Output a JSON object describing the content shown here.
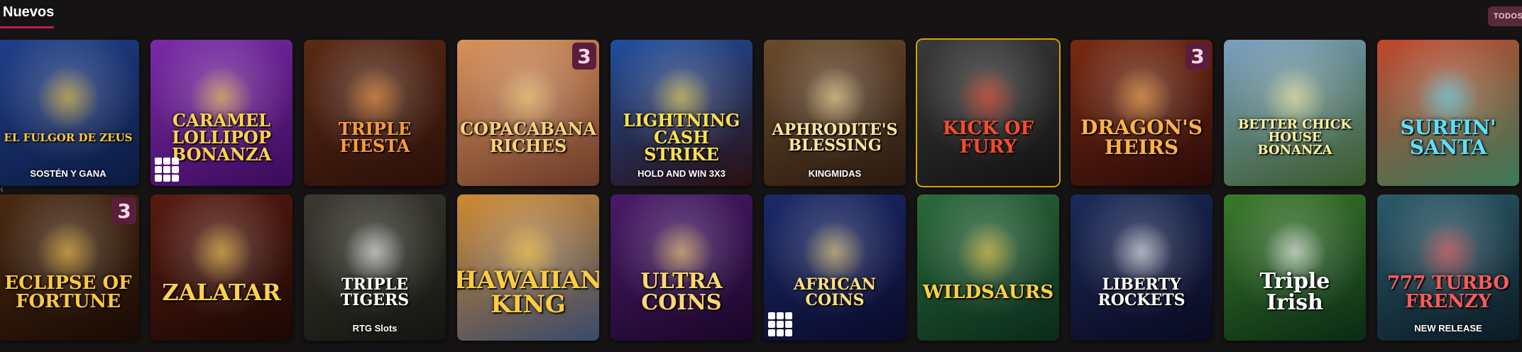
{
  "section": {
    "title": "Nuevos",
    "all_label": "TODOS"
  },
  "games": [
    {
      "name": "EL FULGOR DE ZEUS",
      "subtitle": "SOSTÉN Y GANA",
      "bg1": "#1f3f8a",
      "bg2": "#0b1a40",
      "text": "#ffcc33",
      "size": "15px"
    },
    {
      "name": "CARAMEL LOLLIPOP BONANZA",
      "bg1": "#7b2aa8",
      "bg2": "#3b0b5a",
      "text": "#ffd34a",
      "size": "24px",
      "dots": true
    },
    {
      "name": "TRIPLE FIESTA",
      "bg1": "#5a2a14",
      "bg2": "#2a0f08",
      "text": "#ff9a3c",
      "size": "24px"
    },
    {
      "name": "COPACABANA RICHES",
      "bg1": "#d9925a",
      "bg2": "#6b3a2a",
      "text": "#f7d27a",
      "size": "24px",
      "badge": "3"
    },
    {
      "name": "LIGHTNING CASH STRIKE",
      "subtitle": "HOLD AND WIN 3X3",
      "bg1": "#1f4fa0",
      "bg2": "#2a0f10",
      "text": "#ffe04a",
      "size": "24px"
    },
    {
      "name": "APHRODITE'S BLESSING",
      "subtitle": "KINGMIDAS",
      "bg1": "#6a4a2a",
      "bg2": "#2a1a10",
      "text": "#ffe7a0",
      "size": "22px"
    },
    {
      "name": "KICK OF FURY",
      "bg1": "#3a3a3a",
      "bg2": "#111",
      "text": "#ff4a2a",
      "size": "26px",
      "border": "#d4a200"
    },
    {
      "name": "DRAGON'S HEIRS",
      "bg1": "#7a2a10",
      "bg2": "#2a0a08",
      "text": "#ffb24a",
      "size": "28px",
      "badge": "3"
    },
    {
      "name": "BETTER CHICK HOUSE BONANZA",
      "bg1": "#7aa0c0",
      "bg2": "#3a5a2a",
      "text": "#fff29a",
      "size": "18px"
    },
    {
      "name": "SURFIN' SANTA",
      "bg1": "#c0462a",
      "bg2": "#3a7a5a",
      "text": "#5ae0ff",
      "size": "28px"
    },
    {
      "name": "ECLIPSE OF FORTUNE",
      "bg1": "#4a2a10",
      "bg2": "#1a0a04",
      "text": "#ffc840",
      "size": "26px",
      "badge": "3"
    },
    {
      "name": "ZALATAR",
      "bg1": "#5a1a10",
      "bg2": "#1a0804",
      "text": "#ffd24a",
      "size": "32px"
    },
    {
      "name": "TRIPLE TIGERS",
      "subtitle": "RTG Slots",
      "bg1": "#3a3a30",
      "bg2": "#141410",
      "text": "#ffffff",
      "size": "22px"
    },
    {
      "name": "HAWAIIAN KING",
      "bg1": "#d08a30",
      "bg2": "#3a4a6a",
      "text": "#ffcc40",
      "size": "34px"
    },
    {
      "name": "ULTRA COINS",
      "bg1": "#4a1a6a",
      "bg2": "#1a0628",
      "text": "#ffd870",
      "size": "30px"
    },
    {
      "name": "AFRICAN COINS",
      "bg1": "#1a2a6a",
      "bg2": "#0a0a2a",
      "text": "#ffe07a",
      "size": "22px",
      "dots": true
    },
    {
      "name": "WILDSAURS",
      "bg1": "#2a6a3a",
      "bg2": "#0a2a1a",
      "text": "#ffd040",
      "size": "26px"
    },
    {
      "name": "LIBERTY ROCKETS",
      "bg1": "#1a2a5a",
      "bg2": "#0a0a20",
      "text": "#ffffff",
      "size": "22px"
    },
    {
      "name": "Triple Irish",
      "bg1": "#3a7a2a",
      "bg2": "#0a2a14",
      "text": "#ffffff",
      "size": "30px"
    },
    {
      "name": "777 TURBO FRENZY",
      "subtitle": "NEW RELEASE",
      "bg1": "#2a5a6a",
      "bg2": "#0a1a24",
      "text": "#ff5a5a",
      "size": "26px"
    }
  ]
}
